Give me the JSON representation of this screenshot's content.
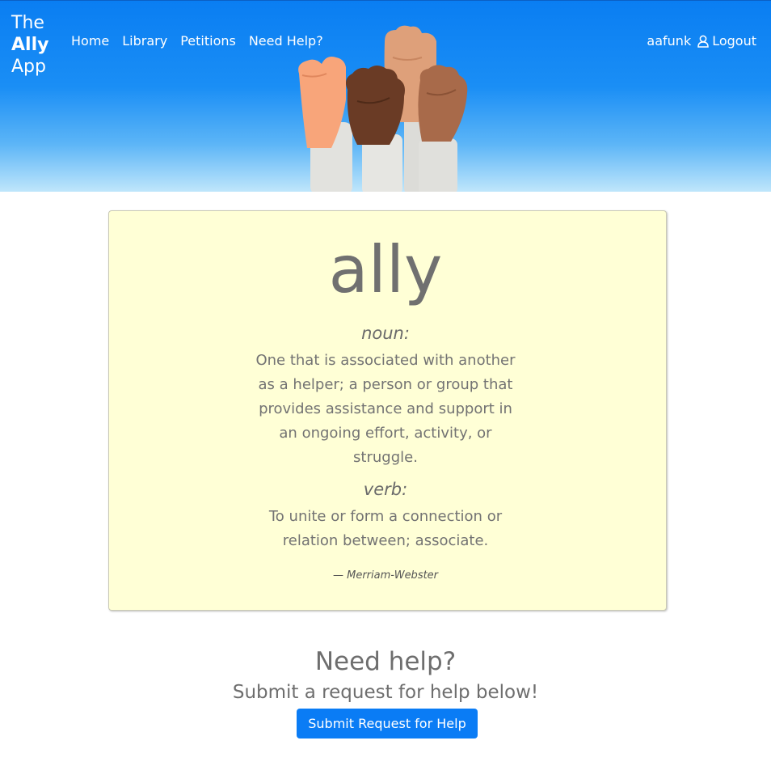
{
  "brand": {
    "line1": "The",
    "line2": "Ally",
    "line3": "App"
  },
  "nav": {
    "home": "Home",
    "library": "Library",
    "petitions": "Petitions",
    "need_help": "Need Help?"
  },
  "user": {
    "username": "aafunk",
    "logout": "Logout"
  },
  "definition": {
    "word": "ally",
    "noun_label": "noun:",
    "noun_text": "One that is associated with another as a helper; a person or group that provides assistance and support in an ongoing effort, activity, or struggle.",
    "verb_label": "verb:",
    "verb_text": "To unite or form a connection or relation between; associate.",
    "source": "— Merriam-Webster"
  },
  "help": {
    "title": "Need help?",
    "subtitle": "Submit a request for help below!",
    "button": "Submit Request for Help"
  },
  "colors": {
    "header_blue": "#0a7ef2",
    "card_bg": "#ffffd6",
    "button_blue": "#0a7cf5"
  },
  "icons": {
    "user": "user-icon",
    "hero": "raised-fists-illustration"
  }
}
